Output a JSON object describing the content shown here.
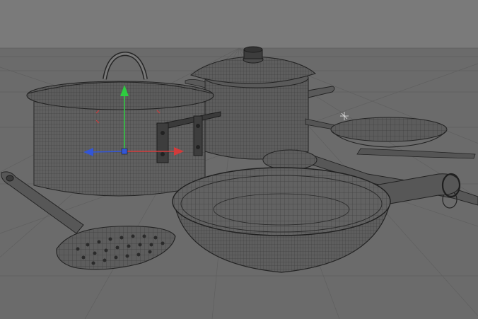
{
  "viewport": {
    "background_color": "#6b6b6b",
    "sky_color": "#7a7a7a",
    "floor_color": "#6b6b6b",
    "wire_color": "#2e2e2e",
    "objects": [
      "stockpot-with-lid",
      "saucepan-with-lid",
      "frying-pan-large",
      "frying-pan-small",
      "slotted-spoon",
      "ladle"
    ],
    "gizmo": {
      "type": "move",
      "x_axis_color": "#d23b3b",
      "y_axis_color": "#2ecc40",
      "z_axis_color": "#3356d6"
    }
  }
}
